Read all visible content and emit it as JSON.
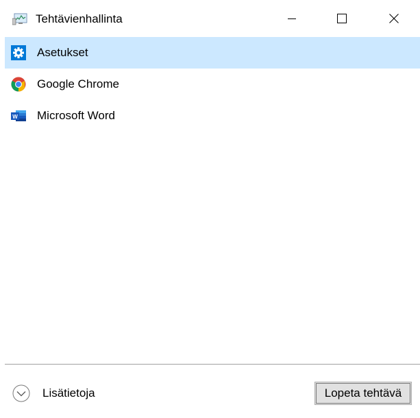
{
  "window": {
    "title": "Tehtävienhallinta",
    "icon": "task-manager-icon"
  },
  "window_controls": {
    "minimize": "minimize-icon",
    "maximize": "maximize-icon",
    "close": "close-icon"
  },
  "apps": [
    {
      "label": "Asetukset",
      "icon": "settings-gear-icon",
      "selected": true,
      "color": "#0078d7"
    },
    {
      "label": "Google Chrome",
      "icon": "chrome-icon",
      "selected": false
    },
    {
      "label": "Microsoft Word",
      "icon": "word-icon",
      "selected": false,
      "color": "#2b579a"
    }
  ],
  "footer": {
    "details_label": "Lisätietoja",
    "end_task_label": "Lopeta tehtävä"
  },
  "colors": {
    "selection": "#cce8ff",
    "divider": "#a0a0a0",
    "button_bg": "#e1e1e1"
  }
}
